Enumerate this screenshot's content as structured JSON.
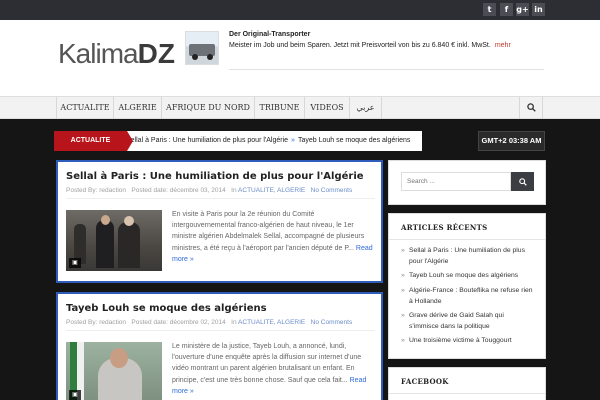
{
  "social": {
    "icons": [
      {
        "name": "twitter-icon",
        "glyph": "t"
      },
      {
        "name": "facebook-icon",
        "glyph": "f"
      },
      {
        "name": "google-plus-icon",
        "glyph": "g+"
      },
      {
        "name": "linkedin-icon",
        "glyph": "in"
      }
    ]
  },
  "header": {
    "logo_light": "Kalima",
    "logo_bold": "DZ",
    "ad": {
      "title": "Der Original-Transporter",
      "text": "Meister im Job und beim Sparen. Jetzt mit Preisvorteil von bis zu 6.840 € inkl. MwSt.",
      "more": "mehr"
    }
  },
  "nav": {
    "items": [
      "ACTUALITE",
      "ALGERIE",
      "AFRIQUE DU NORD",
      "TRIBUNE",
      "VIDEOS",
      "عربي"
    ],
    "search_icon": "search-icon"
  },
  "ticker": {
    "label": "ACTUALITE",
    "items": [
      "Sellal à Paris : Une humiliation de plus pour l'Algérie",
      "Tayeb Louh se moque des algériens"
    ]
  },
  "clock": "GMT+2 03:38 AM",
  "posts": [
    {
      "title": "Sellal à Paris : Une humiliation de plus pour l'Algérie",
      "posted_by_label": "Posted By:",
      "author": "redaction",
      "posted_date_label": "Posted date:",
      "date": "décembre 03, 2014",
      "in_label": "In",
      "categories": "ACTUALITE, ALGERIE",
      "comments": "No Comments",
      "excerpt": " En visite à Paris pour la 2e réunion du Comité intergouvernemental franco-algérien de haut niveau, le 1er ministre algérien Abdelmalek Sellal, accompagné de plusieurs ministres, a été reçu à l'aéroport par l'ancien député de P...",
      "read_more": "Read more »"
    },
    {
      "title": "Tayeb Louh se moque des algériens",
      "posted_by_label": "Posted By:",
      "author": "redaction",
      "posted_date_label": "Posted date:",
      "date": "décembre 02, 2014",
      "in_label": "In",
      "categories": "ACTUALITE, ALGERIE",
      "comments": "No Comments",
      "excerpt": "Le ministère de la justice, Tayeb Louh, a annoncé, lundi, l'ouverture d'une enquête après la diffusion sur internet d'une vidéo montrant un parent algérien brutalisant un enfant. En principe, c'est une très bonne chose. Sauf que cela fait...",
      "read_more": "Read more »"
    }
  ],
  "sidebar": {
    "search_placeholder": "Search ...",
    "recent_title": "ARTICLES RÉCENTS",
    "recent": [
      "Sellal à Paris : Une humiliation de plus pour l'Algérie",
      "Tayeb Louh se moque des algériens",
      "Algérie-France : Bouteflika ne refuse rien à Hollande",
      "Grave dérive de Gaid Salah qui s'immisce dans la politique",
      "Une troisième victime à Touggourt"
    ],
    "facebook_title": "FACEBOOK"
  },
  "colors": {
    "accent_red": "#b8141b",
    "post_border": "#2f5cbb",
    "link_blue": "#2f6bd8",
    "dark_bg": "#151515"
  }
}
